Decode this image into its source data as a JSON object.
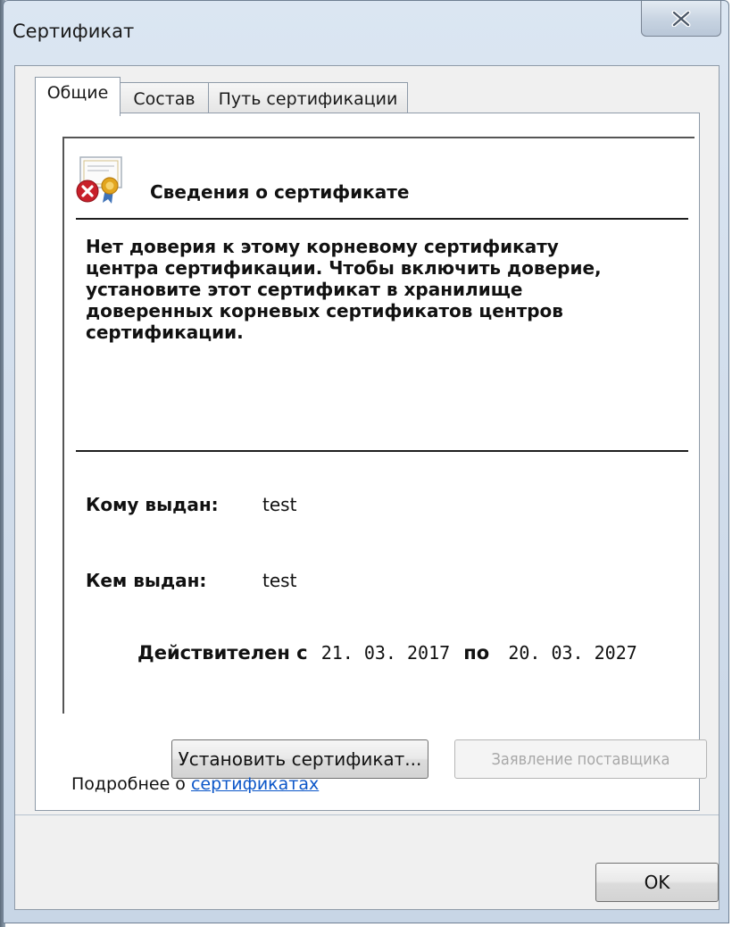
{
  "window": {
    "title": "Сертификат",
    "close_symbol": "X"
  },
  "tabs": [
    {
      "label": "Общие",
      "active": true
    },
    {
      "label": "Состав",
      "active": false
    },
    {
      "label": "Путь сертификации",
      "active": false
    }
  ],
  "info": {
    "title": "Сведения о сертификате",
    "icon": "certificate-error-icon",
    "warning_lines": [
      "Нет доверия к этому корневому сертификату",
      "центра сертификации. Чтобы включить  доверие,",
      "установите этот сертификат в хранилище",
      "доверенных корневых сертификатов центров",
      "сертификации."
    ],
    "issued_to_label": "Кому выдан:",
    "issued_to_value": "test",
    "issued_by_label": "Кем выдан:",
    "issued_by_value": "test",
    "valid_from_label": "Действителен с",
    "valid_from": "21. 03. 2017",
    "valid_to_label": "по",
    "valid_to": "20. 03. 2027"
  },
  "buttons": {
    "install": "Установить сертификат...",
    "issuer_statement": "Заявление поставщика",
    "ok": "OK"
  },
  "more_info": {
    "prefix": "Подробнее о",
    "link": "сертификатах"
  },
  "colors": {
    "link": "#0b56c8",
    "error_red": "#c8202a",
    "seal_gold": "#e2a51e"
  }
}
